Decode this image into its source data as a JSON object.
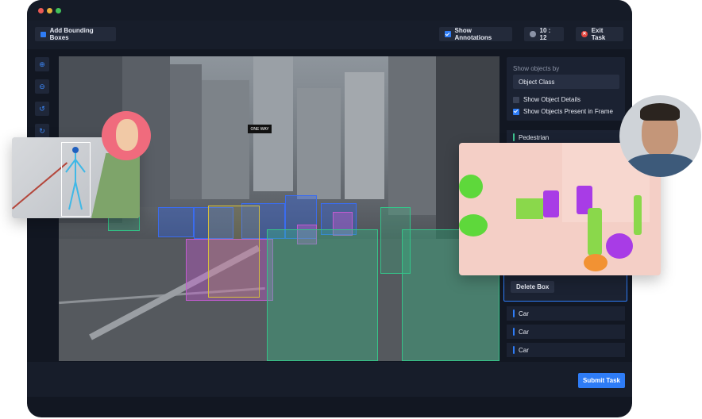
{
  "toolbar": {
    "add_label": "Add Bounding Boxes",
    "show_annotations_label": "Show Annotations",
    "timer": "10 : 12",
    "exit_label": "Exit Task"
  },
  "tools": [
    {
      "name": "zoom-in-icon",
      "glyph": "🔍"
    },
    {
      "name": "zoom-out-icon",
      "glyph": "🔍"
    },
    {
      "name": "undo-icon",
      "glyph": "↺"
    },
    {
      "name": "redo-icon",
      "glyph": "↻"
    }
  ],
  "street_signs": {
    "one_way": "ONE WAY"
  },
  "panel": {
    "show_by_label": "Show objects by",
    "show_by_value": "Object Class",
    "opt_details": "Show Object Details",
    "opt_present": "Show Objects Present in Frame",
    "opt_present_checked": true,
    "opt_details_checked": false
  },
  "objects": {
    "pedestrian": "Pedestrian",
    "delete_box": "Delete Box",
    "car_rows": [
      "Car",
      "Car",
      "Car"
    ]
  },
  "colors": {
    "accent": "#2e7cf6",
    "pedestrian": "#3ec28f",
    "car": "#2e7cf6",
    "exit": "#e4463f"
  },
  "submit_label": "Submit Task"
}
